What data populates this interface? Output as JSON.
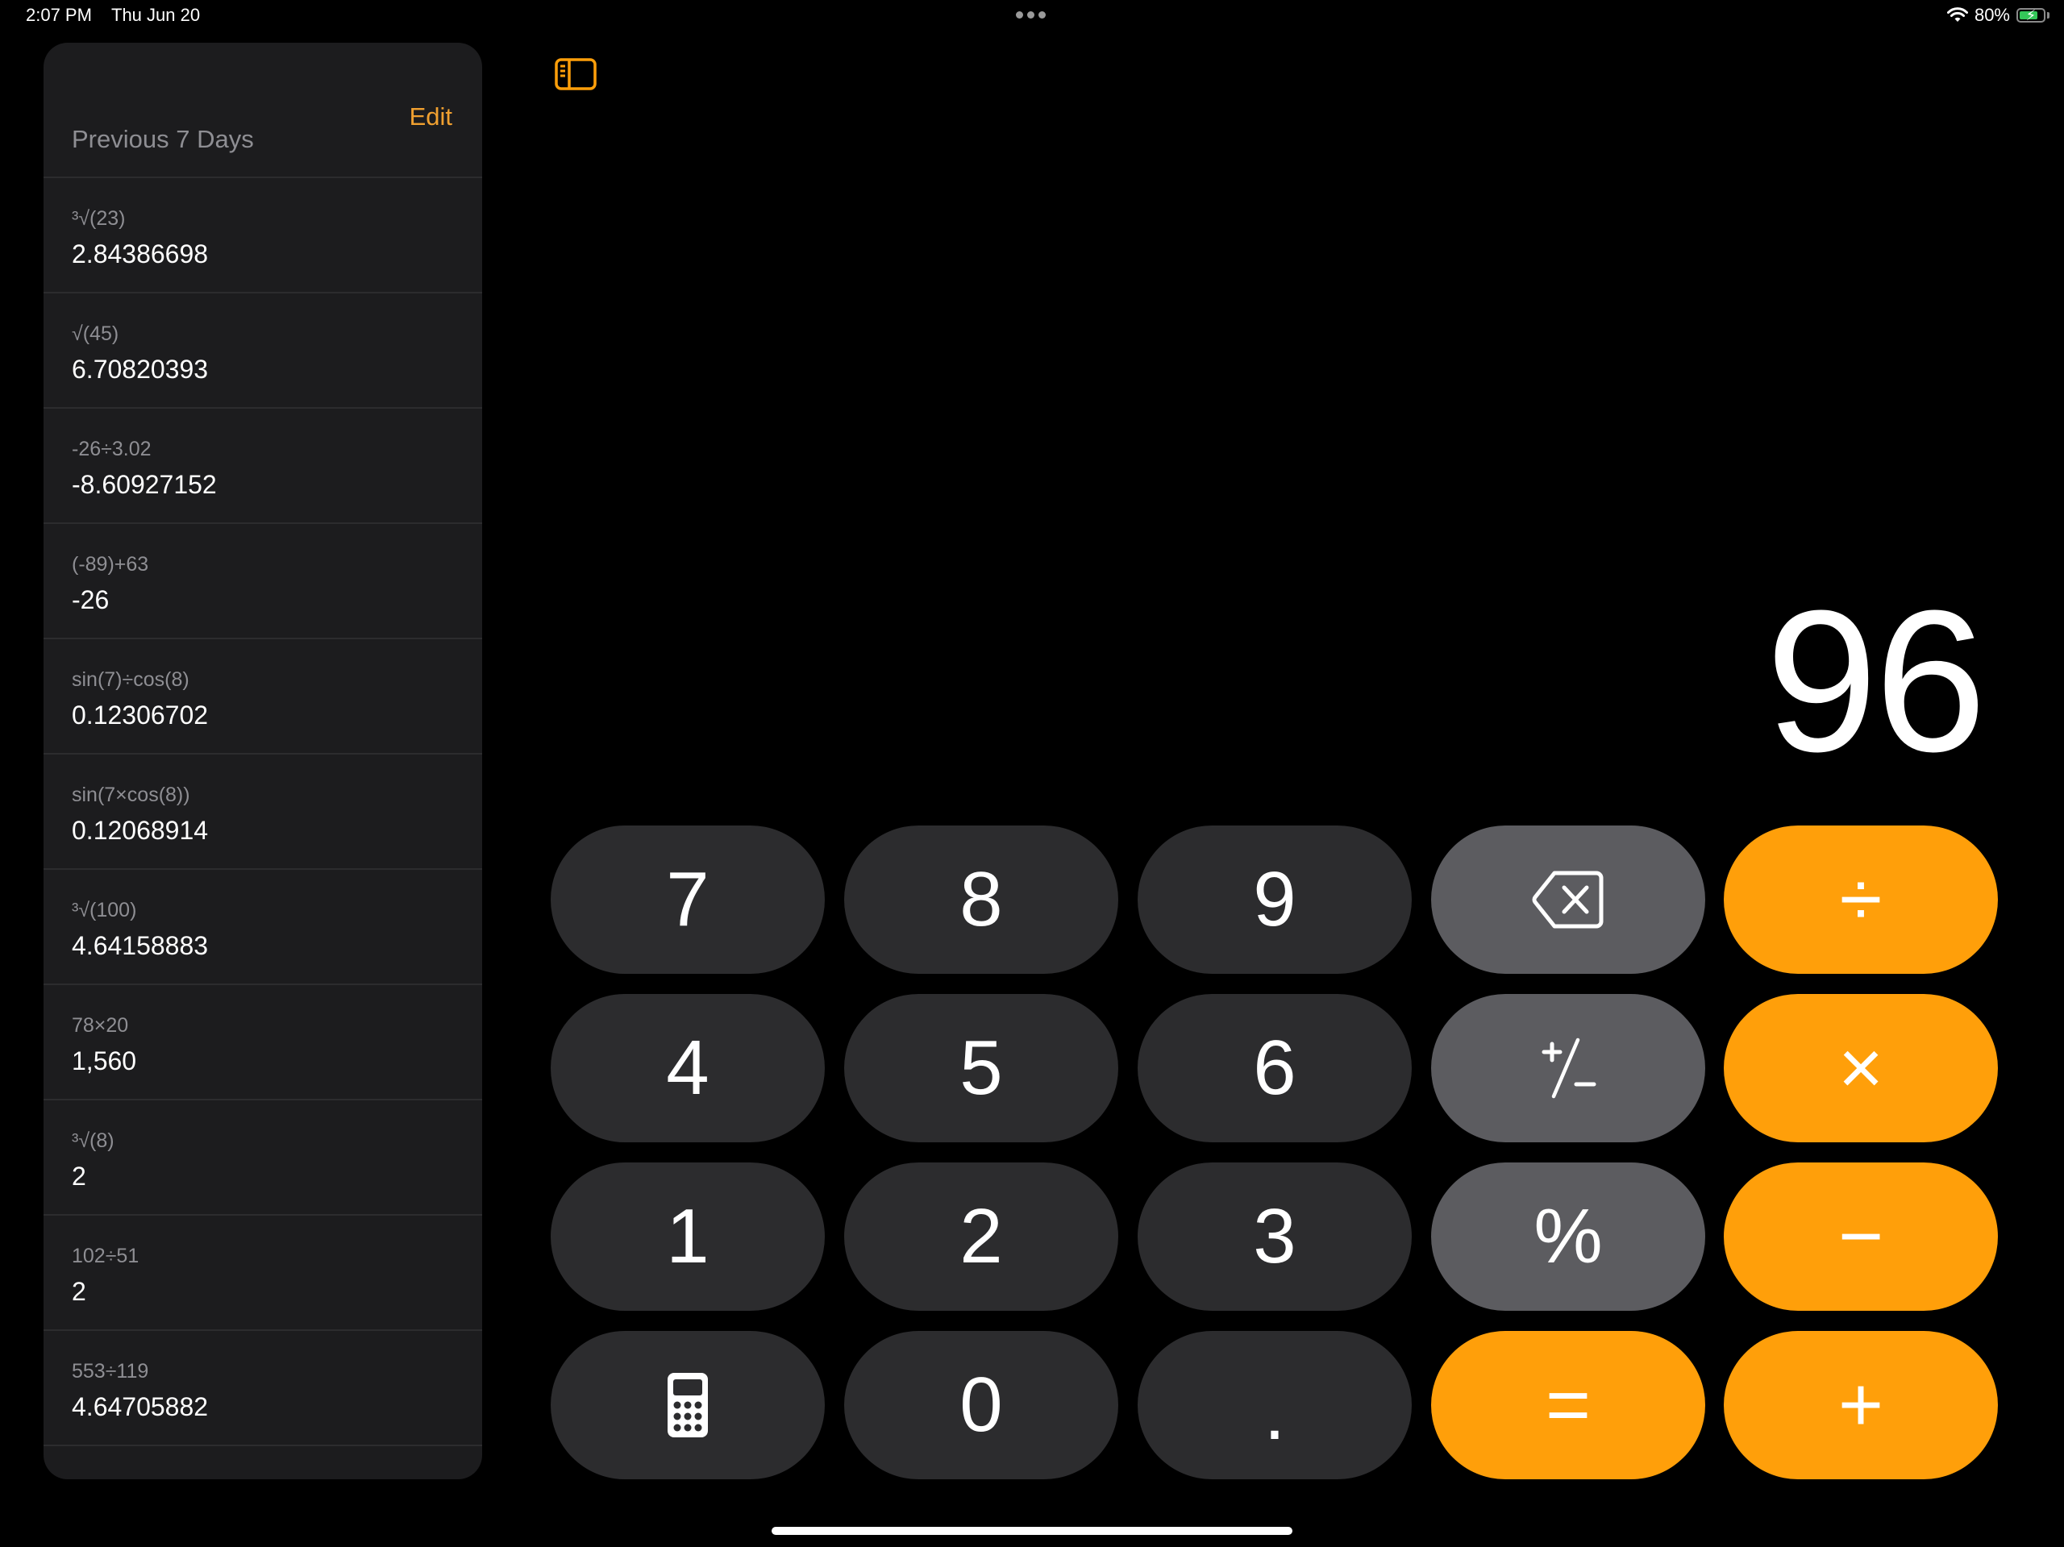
{
  "status_bar": {
    "time": "2:07 PM",
    "date": "Thu Jun 20",
    "battery_percent": "80%",
    "battery_level": 0.8,
    "battery_charging": true,
    "icons": [
      "wifi-icon",
      "battery-icon"
    ]
  },
  "sidebar": {
    "edit_label": "Edit",
    "section_header": "Previous 7 Days",
    "history": [
      {
        "expression": "³√(23)",
        "result": "2.84386698"
      },
      {
        "expression": "√(45)",
        "result": "6.70820393"
      },
      {
        "expression": "-26÷3.02",
        "result": "-8.60927152"
      },
      {
        "expression": "(-89)+63",
        "result": "-26"
      },
      {
        "expression": "sin(7)÷cos(8)",
        "result": "0.12306702"
      },
      {
        "expression": "sin(7×cos(8))",
        "result": "0.12068914"
      },
      {
        "expression": "³√(100)",
        "result": "4.64158883"
      },
      {
        "expression": "78×20",
        "result": "1,560"
      },
      {
        "expression": "³√(8)",
        "result": "2"
      },
      {
        "expression": "102÷51",
        "result": "2"
      },
      {
        "expression": "553÷119",
        "result": "4.64705882"
      }
    ]
  },
  "toolbar": {
    "sidebar_toggle_icon": "sidebar-toggle-icon"
  },
  "display": {
    "value": "96"
  },
  "keypad": {
    "keys": [
      {
        "label": "7",
        "kind": "digit"
      },
      {
        "label": "8",
        "kind": "digit"
      },
      {
        "label": "9",
        "kind": "digit"
      },
      {
        "label": "",
        "icon": "backspace-icon",
        "kind": "function"
      },
      {
        "label": "÷",
        "kind": "operator"
      },
      {
        "label": "4",
        "kind": "digit"
      },
      {
        "label": "5",
        "kind": "digit"
      },
      {
        "label": "6",
        "kind": "digit"
      },
      {
        "label": "",
        "icon": "plus-minus-icon",
        "kind": "function"
      },
      {
        "label": "×",
        "kind": "operator"
      },
      {
        "label": "1",
        "kind": "digit"
      },
      {
        "label": "2",
        "kind": "digit"
      },
      {
        "label": "3",
        "kind": "digit"
      },
      {
        "label": "%",
        "kind": "function"
      },
      {
        "label": "−",
        "kind": "operator"
      },
      {
        "label": "",
        "icon": "calculator-icon",
        "kind": "digit"
      },
      {
        "label": "0",
        "kind": "digit"
      },
      {
        "label": ".",
        "kind": "digit"
      },
      {
        "label": "=",
        "kind": "operator"
      },
      {
        "label": "+",
        "kind": "operator"
      }
    ]
  },
  "colors": {
    "accent": "#ff9f0a",
    "edit_text": "#f0a030",
    "digit_key": "#2c2c2e",
    "function_key": "#5c5c60",
    "sidebar_bg": "#1c1c1e",
    "secondary_text": "#8e8e93",
    "battery_fill": "#34c759"
  }
}
